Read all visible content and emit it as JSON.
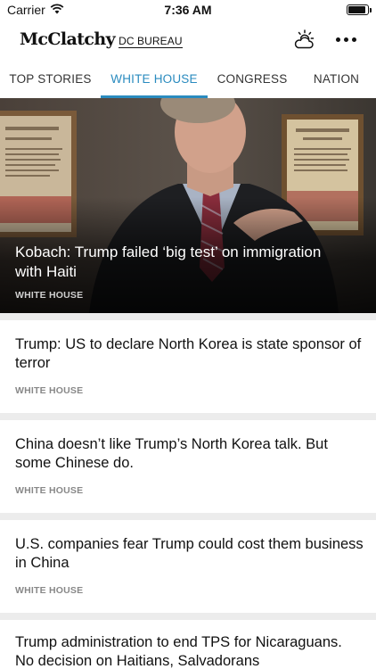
{
  "status_bar": {
    "carrier": "Carrier",
    "time": "7:36 AM",
    "battery_level": 0.9
  },
  "header": {
    "logo_main": "McClatchy",
    "logo_sub": "DC BUREAU",
    "weather_icon": "cloud-sun-icon",
    "more_icon": "more-dots-icon"
  },
  "tabs": [
    {
      "label": "TOP STORIES",
      "active": false
    },
    {
      "label": "WHITE HOUSE",
      "active": true
    },
    {
      "label": "CONGRESS",
      "active": false
    },
    {
      "label": "NATION",
      "active": false
    }
  ],
  "hero": {
    "title": "Kobach: Trump failed ‘big test’ on immigration with Haiti",
    "section": "WHITE HOUSE"
  },
  "articles": [
    {
      "title": "Trump: US to declare North Korea is state sponsor of terror",
      "section": "WHITE HOUSE"
    },
    {
      "title": "China doesn’t like Trump’s North Korea talk. But some Chinese do.",
      "section": "WHITE HOUSE"
    },
    {
      "title": "U.S. companies fear Trump could cost them business in China",
      "section": "WHITE HOUSE"
    },
    {
      "title": "Trump administration to end TPS for Nicaraguans. No decision on Haitians, Salvadorans",
      "section": ""
    }
  ],
  "colors": {
    "accent": "#2a8bbf",
    "page_background": "#ececec",
    "section_label": "#888888"
  }
}
